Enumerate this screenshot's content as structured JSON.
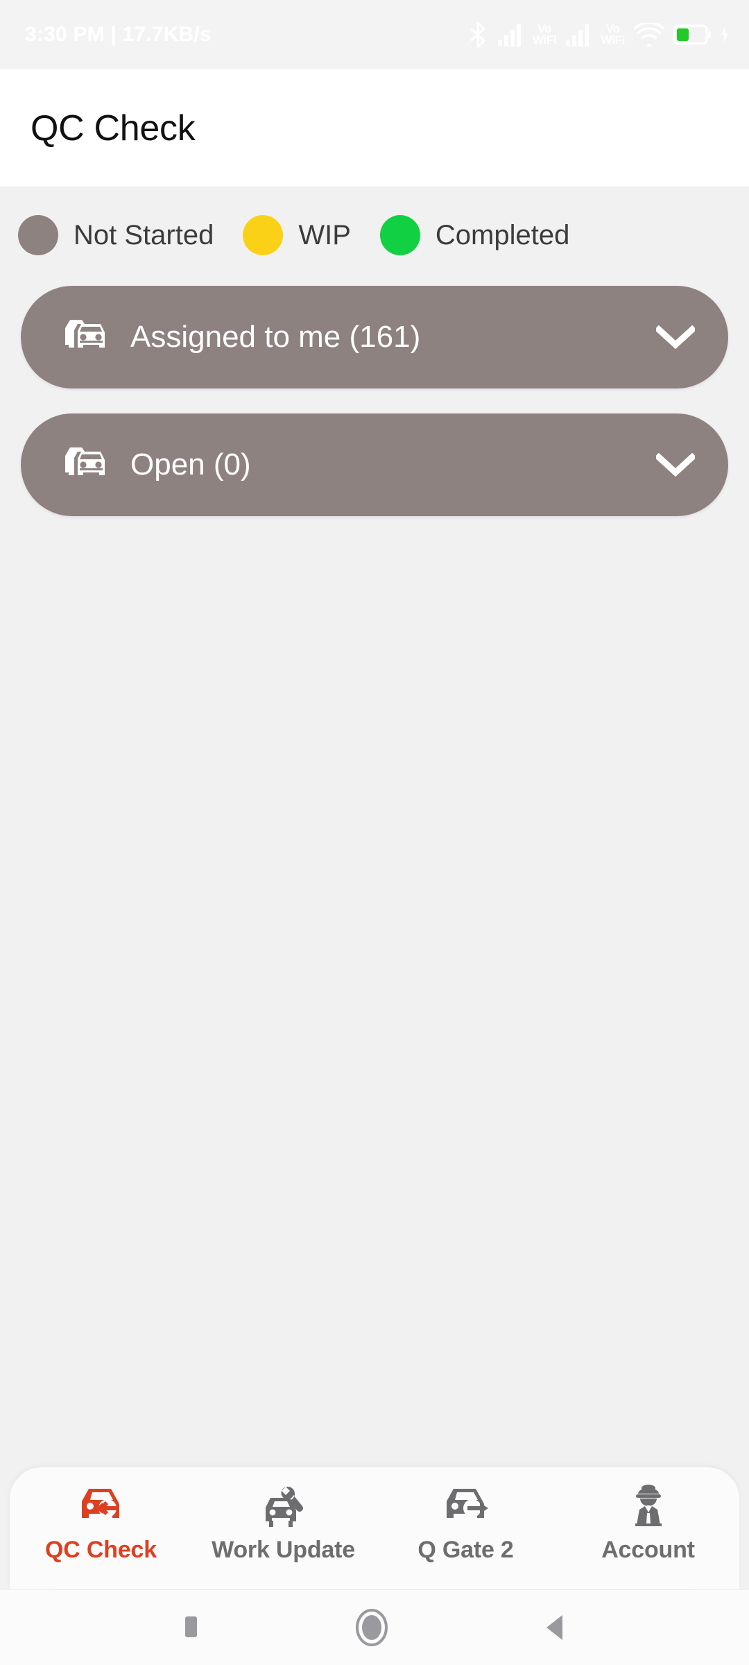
{
  "status_bar": {
    "left_text": "3:30 PM | 17.7KB/s",
    "icons": [
      "bluetooth-icon",
      "signal-bars-icon",
      "vowifi-label-1",
      "signal-bars-2-icon",
      "vowifi-label-2",
      "wifi-icon",
      "battery-icon",
      "charging-bolt-icon"
    ],
    "vowifi_top": "Vo",
    "vowifi_bottom": "WiFi",
    "battery_color": "#22c928"
  },
  "app_bar": {
    "title": "QC Check"
  },
  "legend": {
    "items": [
      {
        "label": "Not Started",
        "color": "#8d8280"
      },
      {
        "label": "WIP",
        "color": "#fbd117"
      },
      {
        "label": "Completed",
        "color": "#11d143"
      }
    ]
  },
  "groups": {
    "card_color": "#8d8280",
    "items": [
      {
        "label": "Assigned to me (161)",
        "icon": "car-front-icon",
        "chevron": "chevron-down-icon"
      },
      {
        "label": "Open (0)",
        "icon": "car-front-icon",
        "chevron": "chevron-down-icon"
      }
    ]
  },
  "bottom_nav": {
    "active_color": "#dd4021",
    "inactive_color": "#6d6d70",
    "tabs": [
      {
        "label": "QC Check",
        "icon": "car-arrow-left-icon",
        "active": true
      },
      {
        "label": "Work Update",
        "icon": "car-wrench-icon",
        "active": false
      },
      {
        "label": "Q Gate 2",
        "icon": "car-arrow-right-icon",
        "active": false
      },
      {
        "label": "Account",
        "icon": "chauffeur-icon",
        "active": false
      }
    ]
  },
  "system_nav": {
    "buttons": [
      "recents-square-icon",
      "home-circle-icon",
      "back-triangle-icon"
    ],
    "color": "#9a9a9e"
  }
}
